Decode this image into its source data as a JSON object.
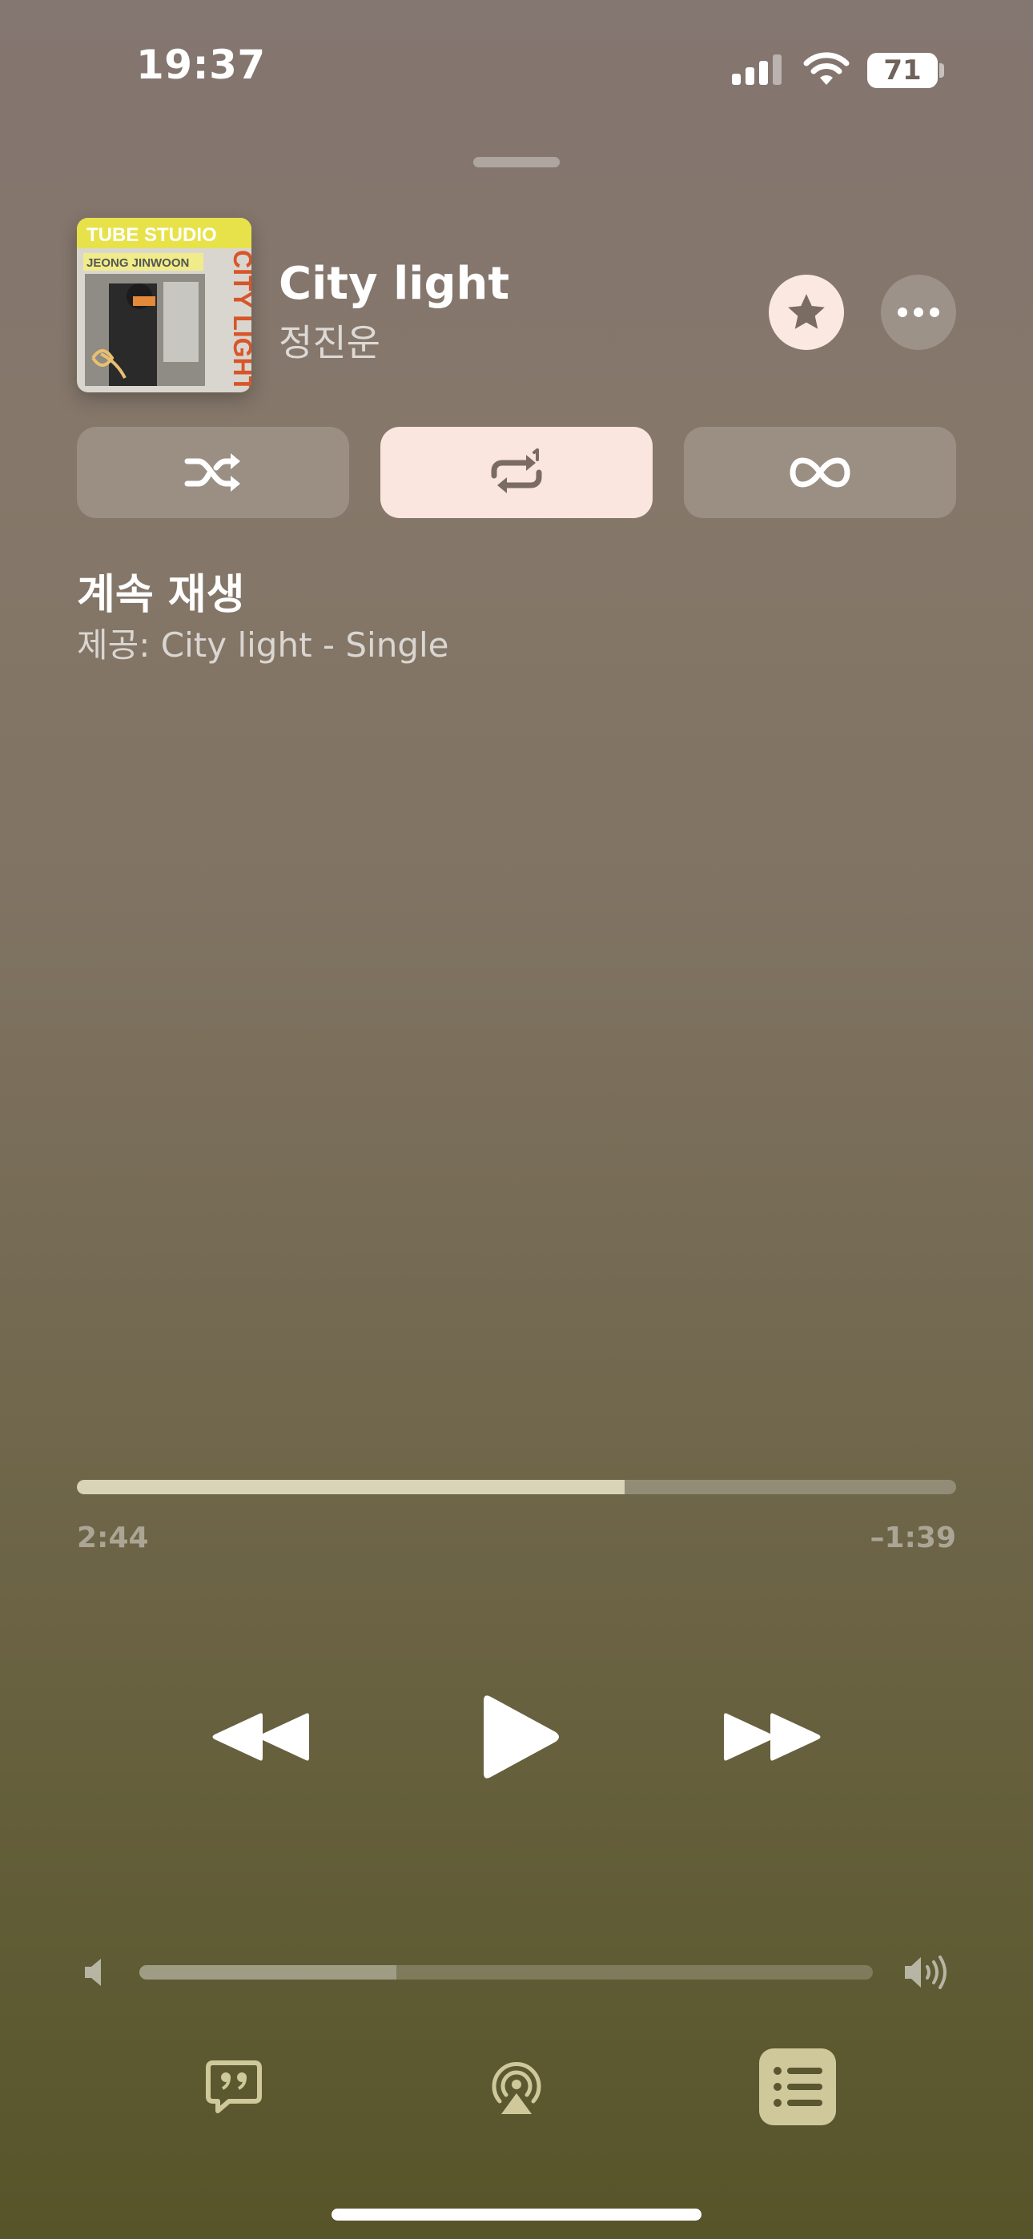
{
  "status_bar": {
    "time": "19:37",
    "battery_level": "71",
    "icons": [
      "cellular-signal-icon",
      "wifi-icon",
      "battery-icon"
    ]
  },
  "now_playing": {
    "title": "City light",
    "artist": "정진운",
    "artwork": {
      "text_top": "TUBE STUDIO",
      "text_artist": "JEONG JINWOON",
      "text_side": "CITY LIGHT"
    },
    "favorite_icon": "star-icon",
    "more_icon": "ellipsis-icon"
  },
  "modes": [
    {
      "name": "shuffle",
      "icon": "shuffle-icon",
      "active": false
    },
    {
      "name": "repeat-one",
      "icon": "repeat-one-icon",
      "active": true
    },
    {
      "name": "autoplay",
      "icon": "infinity-icon",
      "active": false
    }
  ],
  "autoplay": {
    "title": "계속 재생",
    "subtitle": "제공: City light - Single"
  },
  "progress": {
    "elapsed": "2:44",
    "remaining": "–1:39",
    "fraction": 0.623
  },
  "transport": {
    "icons": [
      "rewind-icon",
      "play-icon",
      "fast-forward-icon"
    ]
  },
  "volume": {
    "level": 0.35,
    "icons": [
      "volume-low-icon",
      "volume-high-icon"
    ]
  },
  "bottom_bar": {
    "icons": [
      "lyrics-icon",
      "airplay-icon",
      "queue-icon"
    ],
    "queue_active": true
  },
  "colors": {
    "accent_light": "#fae6de",
    "progress_fill": "#d9d3b8",
    "queue_active_bg": "#cfc89a"
  }
}
